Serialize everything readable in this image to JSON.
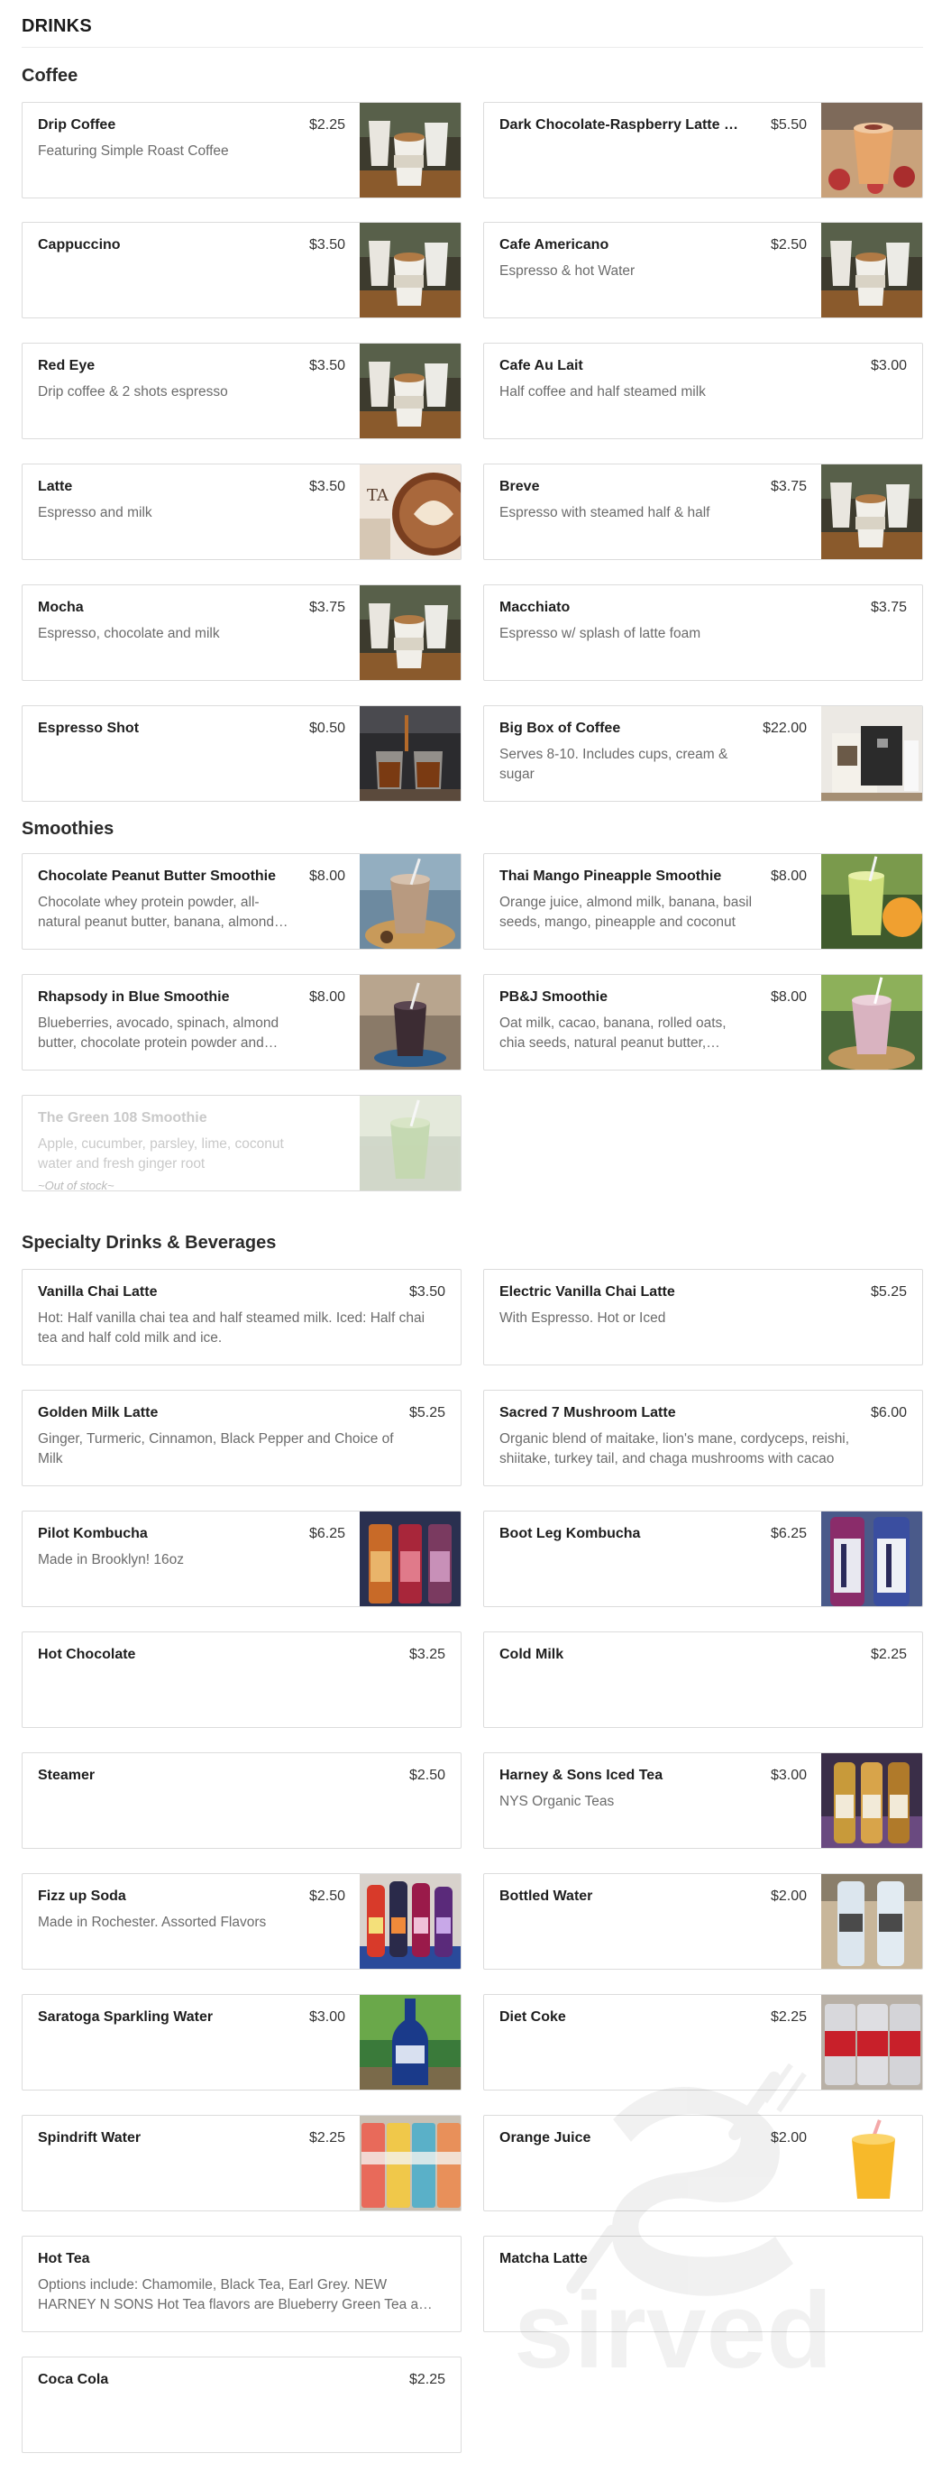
{
  "menu": {
    "title": "DRINKS",
    "sections": {
      "coffee": "Coffee",
      "smoothies": "Smoothies",
      "specialty": "Specialty Drinks & Beverages"
    },
    "items": {
      "drip_coffee": {
        "name": "Drip Coffee",
        "price": "$2.25",
        "desc": "Featuring Simple Roast Coffee"
      },
      "dark_chocolate_raspberry": {
        "name": "Dark Chocolate-Raspberry Latte with Espresso",
        "price": "$5.50",
        "desc": ""
      },
      "cappuccino": {
        "name": "Cappuccino",
        "price": "$3.50",
        "desc": ""
      },
      "cafe_americano": {
        "name": "Cafe Americano",
        "price": "$2.50",
        "desc": "Espresso & hot Water"
      },
      "red_eye": {
        "name": "Red Eye",
        "price": "$3.50",
        "desc": "Drip coffee & 2 shots espresso"
      },
      "cafe_au_lait": {
        "name": "Cafe Au Lait",
        "price": "$3.00",
        "desc": "Half coffee and half steamed milk"
      },
      "latte": {
        "name": "Latte",
        "price": "$3.50",
        "desc": "Espresso and milk"
      },
      "breve": {
        "name": "Breve",
        "price": "$3.75",
        "desc": "Espresso with steamed half & half"
      },
      "mocha": {
        "name": "Mocha",
        "price": "$3.75",
        "desc": "Espresso, chocolate and milk"
      },
      "macchiato": {
        "name": "Macchiato",
        "price": "$3.75",
        "desc": "Espresso w/ splash of latte foam"
      },
      "espresso_shot": {
        "name": "Espresso Shot",
        "price": "$0.50",
        "desc": ""
      },
      "big_box": {
        "name": "Big Box of Coffee",
        "price": "$22.00",
        "desc": "Serves 8-10. Includes cups, cream & sugar"
      },
      "cpb_smoothie": {
        "name": "Chocolate Peanut Butter Smoothie",
        "price": "$8.00",
        "desc": "Chocolate whey protein powder, all-natural peanut butter, banana, almond milk and ice"
      },
      "thai_mango": {
        "name": "Thai Mango Pineapple Smoothie",
        "price": "$8.00",
        "desc": "Orange juice, almond milk, banana, basil seeds, mango, pineapple and coconut"
      },
      "rhapsody": {
        "name": "Rhapsody in Blue Smoothie",
        "price": "$8.00",
        "desc": "Blueberries, avocado, spinach, almond butter, chocolate protein powder and almond milk"
      },
      "pbj": {
        "name": "PB&J Smoothie",
        "price": "$8.00",
        "desc": "Oat milk, cacao, banana, rolled oats, chia seeds, natural peanut butter, strawberries"
      },
      "green_108": {
        "name": "The Green 108 Smoothie",
        "price": "",
        "desc": "Apple, cucumber, parsley, lime, coconut water and fresh ginger root",
        "stock": "~Out of stock~"
      },
      "vanilla_chai": {
        "name": "Vanilla Chai Latte",
        "price": "$3.50",
        "desc": "Hot: Half vanilla chai tea and half steamed milk. Iced: Half chai tea and half cold milk and ice."
      },
      "electric_chai": {
        "name": "Electric Vanilla Chai Latte",
        "price": "$5.25",
        "desc": "With Espresso. Hot or Iced"
      },
      "golden_milk": {
        "name": "Golden Milk Latte",
        "price": "$5.25",
        "desc": "Ginger, Turmeric, Cinnamon, Black Pepper and Choice of Milk"
      },
      "sacred_mushroom": {
        "name": "Sacred 7 Mushroom Latte",
        "price": "$6.00",
        "desc": "Organic blend of maitake, lion's mane, cordyceps, reishi, shiitake, turkey tail, and chaga mushrooms with cacao"
      },
      "pilot_kombucha": {
        "name": "Pilot Kombucha",
        "price": "$6.25",
        "desc": "Made in Brooklyn! 16oz"
      },
      "bootleg_kombucha": {
        "name": "Boot Leg Kombucha",
        "price": "$6.25",
        "desc": ""
      },
      "hot_chocolate": {
        "name": "Hot Chocolate",
        "price": "$3.25",
        "desc": ""
      },
      "cold_milk": {
        "name": "Cold Milk",
        "price": "$2.25",
        "desc": ""
      },
      "steamer": {
        "name": "Steamer",
        "price": "$2.50",
        "desc": ""
      },
      "harney_iced": {
        "name": "Harney & Sons Iced Tea",
        "price": "$3.00",
        "desc": "NYS Organic Teas"
      },
      "fizz_soda": {
        "name": "Fizz up Soda",
        "price": "$2.50",
        "desc": "Made in Rochester. Assorted Flavors"
      },
      "bottled_water": {
        "name": "Bottled Water",
        "price": "$2.00",
        "desc": ""
      },
      "saratoga": {
        "name": "Saratoga Sparkling Water",
        "price": "$3.00",
        "desc": ""
      },
      "diet_coke": {
        "name": "Diet Coke",
        "price": "$2.25",
        "desc": ""
      },
      "spindrift": {
        "name": "Spindrift Water",
        "price": "$2.25",
        "desc": ""
      },
      "orange_juice": {
        "name": "Orange Juice",
        "price": "$2.00",
        "desc": ""
      },
      "hot_tea": {
        "name": "Hot Tea",
        "price": "",
        "desc": "Options include: Chamomile, Black Tea, Earl Grey. NEW HARNEY N SONS Hot Tea flavors are Blueberry Green Tea and Peach"
      },
      "matcha": {
        "name": "Matcha Latte",
        "price": "",
        "desc": ""
      },
      "coca_cola": {
        "name": "Coca Cola",
        "price": "$2.25",
        "desc": ""
      }
    }
  },
  "watermark": {
    "text": "sirved"
  },
  "colors": {
    "border": "#dcdcdc",
    "muted_text": "#6b6b6b",
    "out_of_stock": "#c9c9c9"
  }
}
